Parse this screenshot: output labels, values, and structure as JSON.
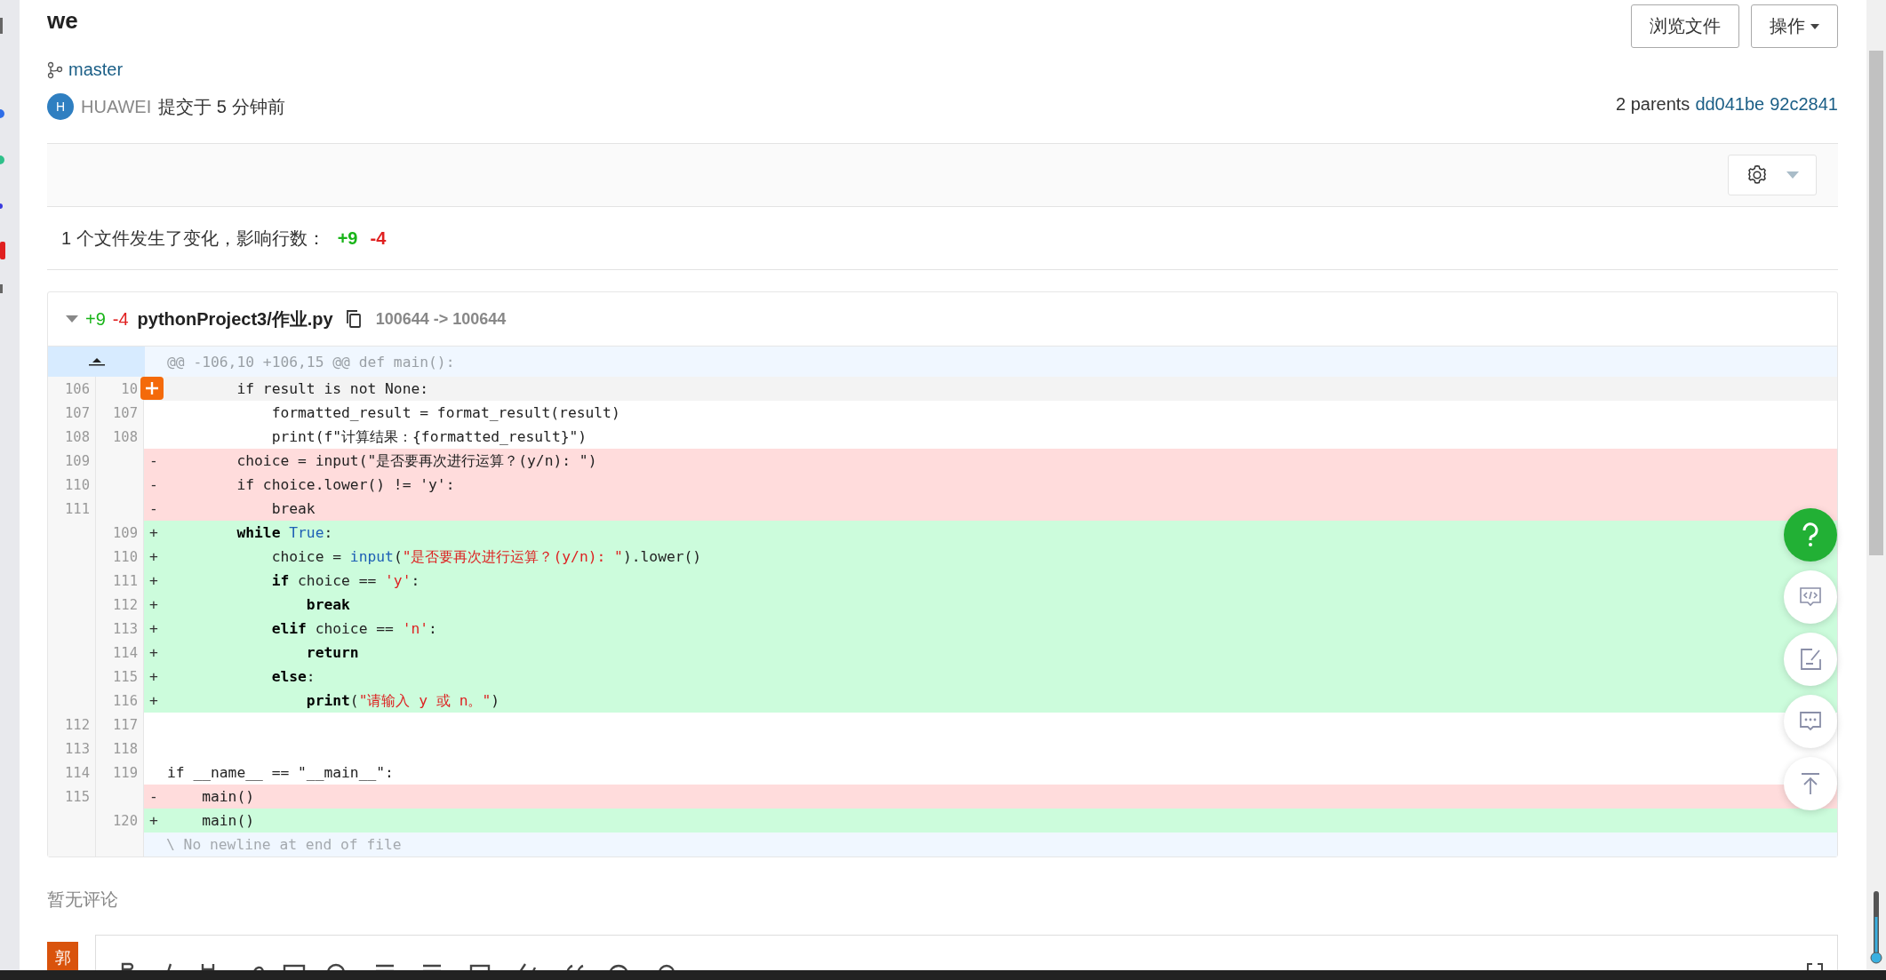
{
  "commit": {
    "title": "we",
    "branch": "master",
    "author_initial": "H",
    "author": "HUAWEI",
    "committed": "提交于 5 分钟前",
    "parents_label": "2 parents",
    "parents": [
      "dd041be",
      "92c2841"
    ]
  },
  "actions": [
    {
      "label": "浏览文件",
      "kind": "button"
    },
    {
      "label": "操作",
      "kind": "dropdown"
    }
  ],
  "summary": {
    "text": "1 个文件发生了变化，影响行数：",
    "added": "+9",
    "removed": "-4"
  },
  "file": {
    "expanded": true,
    "added": "+9",
    "removed": "-4",
    "path": "pythonProject3/作业.py",
    "mode": "100644 -> 100644",
    "hunk": "@@ -106,10 +106,15 @@ def main():",
    "note": "\\ No newline at end of file",
    "lines": [
      {
        "old": "106",
        "new": "10",
        "kind": "context",
        "hovered": true,
        "code": [
          {
            "text": "        if result is not None:",
            "kind": "plain"
          }
        ]
      },
      {
        "old": "107",
        "new": "107",
        "kind": "context",
        "hovered": false,
        "code": [
          {
            "text": "            formatted_result = format_result(result)",
            "kind": "plain"
          }
        ]
      },
      {
        "old": "108",
        "new": "108",
        "kind": "context",
        "hovered": false,
        "code": [
          {
            "text": "            print(f\"计算结果：{formatted_result}\")",
            "kind": "plain"
          }
        ]
      },
      {
        "old": "109",
        "kind": "del",
        "sign": "-",
        "hovered": false,
        "code": [
          {
            "text": "        choice = input(\"是否要再次进行运算？(y/n): \")",
            "kind": "plain"
          }
        ]
      },
      {
        "old": "110",
        "kind": "del",
        "sign": "-",
        "hovered": false,
        "code": [
          {
            "text": "        if choice.lower() != 'y':",
            "kind": "plain"
          }
        ]
      },
      {
        "old": "111",
        "kind": "del",
        "sign": "-",
        "hovered": false,
        "code": [
          {
            "text": "            break",
            "kind": "plain"
          }
        ]
      },
      {
        "new": "109",
        "kind": "add",
        "sign": "+",
        "hovered": false,
        "code": [
          {
            "text": "        while",
            "kind": "keyword"
          },
          {
            "text": " True",
            "kind": "builtin"
          },
          {
            "text": ":",
            "kind": "plain"
          }
        ]
      },
      {
        "new": "110",
        "kind": "add",
        "sign": "+",
        "hovered": false,
        "code": [
          {
            "text": "            choice = ",
            "kind": "plain"
          },
          {
            "text": "input",
            "kind": "builtin"
          },
          {
            "text": "(",
            "kind": "plain"
          },
          {
            "text": "\"是否要再次进行运算？(y/n): \"",
            "kind": "string"
          },
          {
            "text": ").lower()",
            "kind": "plain"
          }
        ]
      },
      {
        "new": "111",
        "kind": "add",
        "sign": "+",
        "hovered": false,
        "code": [
          {
            "text": "            if",
            "kind": "keyword"
          },
          {
            "text": " choice == ",
            "kind": "plain"
          },
          {
            "text": "'y'",
            "kind": "string"
          },
          {
            "text": ":",
            "kind": "plain"
          }
        ]
      },
      {
        "new": "112",
        "kind": "add",
        "sign": "+",
        "hovered": false,
        "code": [
          {
            "text": "                break",
            "kind": "keyword"
          }
        ]
      },
      {
        "new": "113",
        "kind": "add",
        "sign": "+",
        "hovered": false,
        "code": [
          {
            "text": "            elif",
            "kind": "keyword"
          },
          {
            "text": " choice == ",
            "kind": "plain"
          },
          {
            "text": "'n'",
            "kind": "string"
          },
          {
            "text": ":",
            "kind": "plain"
          }
        ]
      },
      {
        "new": "114",
        "kind": "add",
        "sign": "+",
        "hovered": false,
        "code": [
          {
            "text": "                return",
            "kind": "keyword"
          }
        ]
      },
      {
        "new": "115",
        "kind": "add",
        "sign": "+",
        "hovered": false,
        "code": [
          {
            "text": "            else",
            "kind": "keyword"
          },
          {
            "text": ":",
            "kind": "plain"
          }
        ]
      },
      {
        "new": "116",
        "kind": "add",
        "sign": "+",
        "hovered": false,
        "code": [
          {
            "text": "                print",
            "kind": "keyword"
          },
          {
            "text": "(",
            "kind": "plain"
          },
          {
            "text": "\"请输入 y 或 n。\"",
            "kind": "string"
          },
          {
            "text": ")",
            "kind": "plain"
          }
        ]
      },
      {
        "old": "112",
        "new": "117",
        "kind": "context",
        "hovered": false
      },
      {
        "old": "113",
        "new": "118",
        "kind": "context",
        "hovered": false
      },
      {
        "old": "114",
        "new": "119",
        "kind": "context",
        "hovered": false,
        "code": [
          {
            "text": "if __name__ == \"__main__\":",
            "kind": "plain"
          }
        ]
      },
      {
        "old": "115",
        "kind": "del",
        "sign": "-",
        "hovered": false,
        "code": [
          {
            "text": "    main()",
            "kind": "plain"
          }
        ]
      },
      {
        "new": "120",
        "kind": "add",
        "sign": "+",
        "hovered": false,
        "code": [
          {
            "text": "    main()",
            "kind": "plain"
          }
        ]
      }
    ]
  },
  "comments": {
    "empty_text": "暂无评论",
    "user_initial": "郭"
  },
  "float_buttons": [
    {
      "kind": "help"
    },
    {
      "kind": "code"
    },
    {
      "kind": "edit"
    },
    {
      "kind": "chat"
    },
    {
      "kind": "top"
    }
  ]
}
